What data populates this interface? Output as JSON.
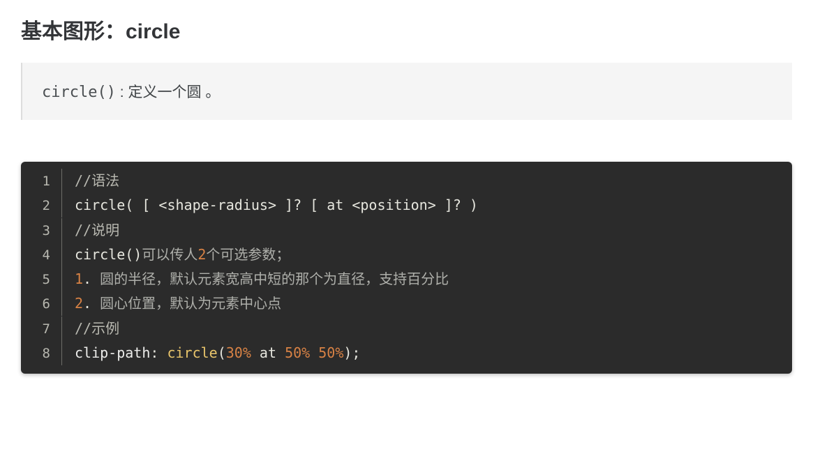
{
  "heading": "基本图形：circle",
  "quote": {
    "mono": "circle()",
    "sep": " : ",
    "desc": "定义一个圆 。"
  },
  "code": {
    "lines": [
      {
        "n": "1",
        "tokens": [
          {
            "cls": "tok-comment",
            "t": "//语法"
          }
        ]
      },
      {
        "n": "2",
        "tokens": [
          {
            "cls": "tok-plain",
            "t": "circle( [ <shape-radius> ]? [ at <position> ]? )"
          }
        ]
      },
      {
        "n": "3",
        "tokens": [
          {
            "cls": "tok-comment",
            "t": "//说明"
          }
        ]
      },
      {
        "n": "4",
        "tokens": [
          {
            "cls": "tok-plain",
            "t": "circle()"
          },
          {
            "cls": "tok-gray",
            "t": "可以传人"
          },
          {
            "cls": "tok-num",
            "t": "2"
          },
          {
            "cls": "tok-gray",
            "t": "个可选参数；"
          }
        ]
      },
      {
        "n": "5",
        "tokens": [
          {
            "cls": "tok-num",
            "t": "1"
          },
          {
            "cls": "tok-plain",
            "t": ". "
          },
          {
            "cls": "tok-gray",
            "t": "圆的半径，默认元素宽高中短的那个为直径，支持百分比"
          }
        ]
      },
      {
        "n": "6",
        "tokens": [
          {
            "cls": "tok-num",
            "t": "2"
          },
          {
            "cls": "tok-plain",
            "t": ". "
          },
          {
            "cls": "tok-gray",
            "t": "圆心位置，默认为元素中心点"
          }
        ]
      },
      {
        "n": "7",
        "tokens": [
          {
            "cls": "tok-comment",
            "t": "//示例"
          }
        ]
      },
      {
        "n": "8",
        "tokens": [
          {
            "cls": "tok-prop",
            "t": "clip-path"
          },
          {
            "cls": "tok-punc",
            "t": ": "
          },
          {
            "cls": "tok-func",
            "t": "circle"
          },
          {
            "cls": "tok-punc",
            "t": "("
          },
          {
            "cls": "tok-orange",
            "t": "30%"
          },
          {
            "cls": "tok-kw",
            "t": " at "
          },
          {
            "cls": "tok-orange",
            "t": "50%"
          },
          {
            "cls": "tok-plain",
            "t": " "
          },
          {
            "cls": "tok-orange",
            "t": "50%"
          },
          {
            "cls": "tok-punc",
            "t": ");"
          }
        ]
      }
    ]
  }
}
